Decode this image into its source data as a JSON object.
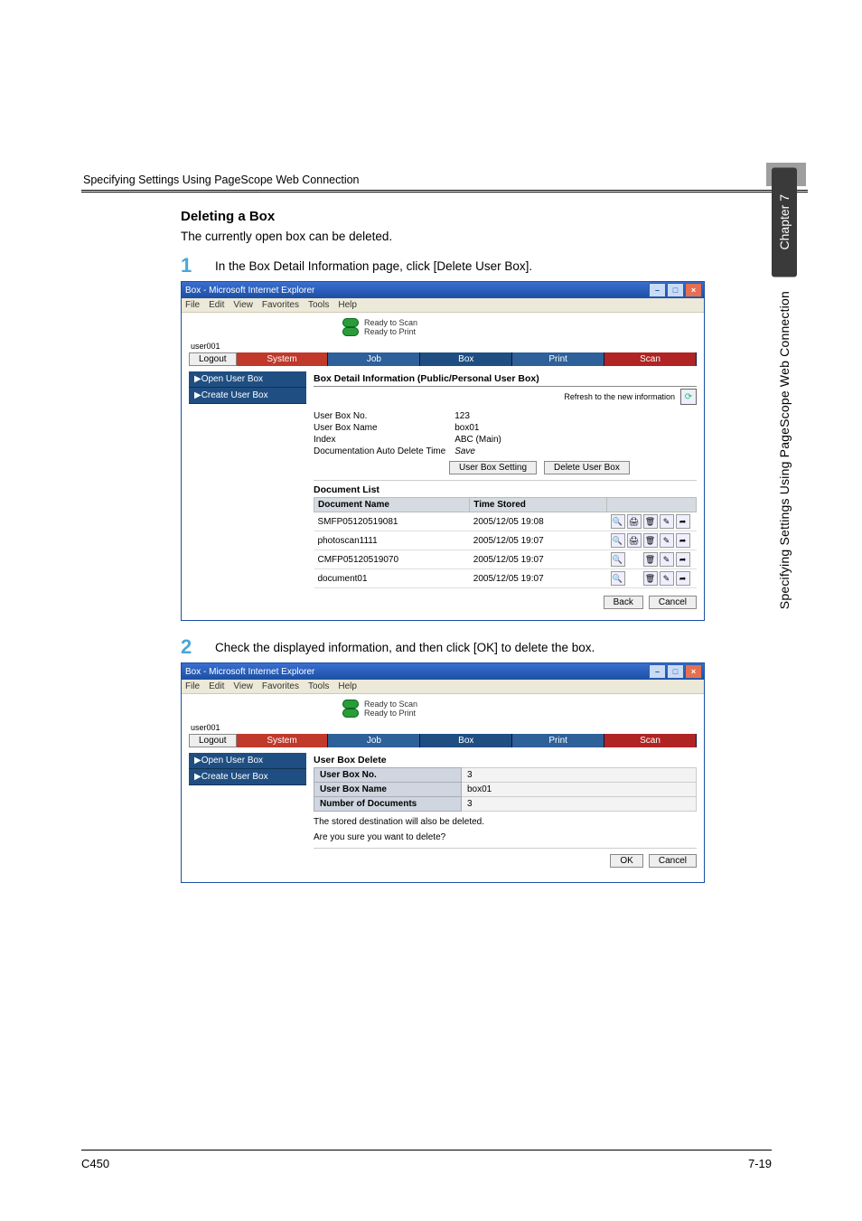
{
  "header": {
    "title": "Specifying Settings Using PageScope Web Connection",
    "chapter_num": "7"
  },
  "side": {
    "chapter": "Chapter 7",
    "title": "Specifying Settings Using PageScope Web Connection"
  },
  "content": {
    "section_title": "Deleting a Box",
    "intro": "The currently open box can be deleted.",
    "step1": "In the Box Detail Information page, click [Delete User Box].",
    "step2": "Check the displayed information, and then click [OK] to delete the box."
  },
  "ie1": {
    "title": "Box - Microsoft Internet Explorer",
    "menus": [
      "File",
      "Edit",
      "View",
      "Favorites",
      "Tools",
      "Help"
    ],
    "status": {
      "scan": "Ready to Scan",
      "print": "Ready to Print"
    },
    "user": "user001",
    "logout": "Logout",
    "tabs": {
      "system": "System",
      "job": "Job",
      "box": "Box",
      "print": "Print",
      "scan": "Scan"
    },
    "nav": {
      "open": "▶Open User Box",
      "create": "▶Create User Box"
    },
    "pane_title": "Box Detail Information (Public/Personal User Box)",
    "refresh_label": "Refresh to the new information",
    "info": {
      "box_no_label": "User Box No.",
      "box_no": "123",
      "box_name_label": "User Box Name",
      "box_name": "box01",
      "index_label": "Index",
      "index": "ABC  (Main)",
      "adt_label": "Documentation Auto Delete Time",
      "adt": "Save"
    },
    "buttons": {
      "setting": "User Box Setting",
      "delete": "Delete User Box",
      "back": "Back",
      "cancel": "Cancel"
    },
    "doclist_title": "Document List",
    "doc_headers": {
      "name": "Document Name",
      "time": "Time Stored"
    },
    "docs": [
      {
        "name": "SMFP05120519081",
        "time": "2005/12/05  19:08"
      },
      {
        "name": "photoscan1111",
        "time": "2005/12/05  19:07"
      },
      {
        "name": "CMFP05120519070",
        "time": "2005/12/05  19:07"
      },
      {
        "name": "document01",
        "time": "2005/12/05  19:07"
      }
    ]
  },
  "ie2": {
    "title": "Box - Microsoft Internet Explorer",
    "pane_title": "User Box Delete",
    "rows": {
      "no_label": "User Box No.",
      "no": "3",
      "name_label": "User Box Name",
      "name": "box01",
      "docs_label": "Number of Documents",
      "docs": "3"
    },
    "confirm1": "The stored destination will also be deleted.",
    "confirm2": "Are you sure you want to delete?",
    "ok": "OK",
    "cancel": "Cancel"
  },
  "footer": {
    "left": "C450",
    "right": "7-19"
  }
}
